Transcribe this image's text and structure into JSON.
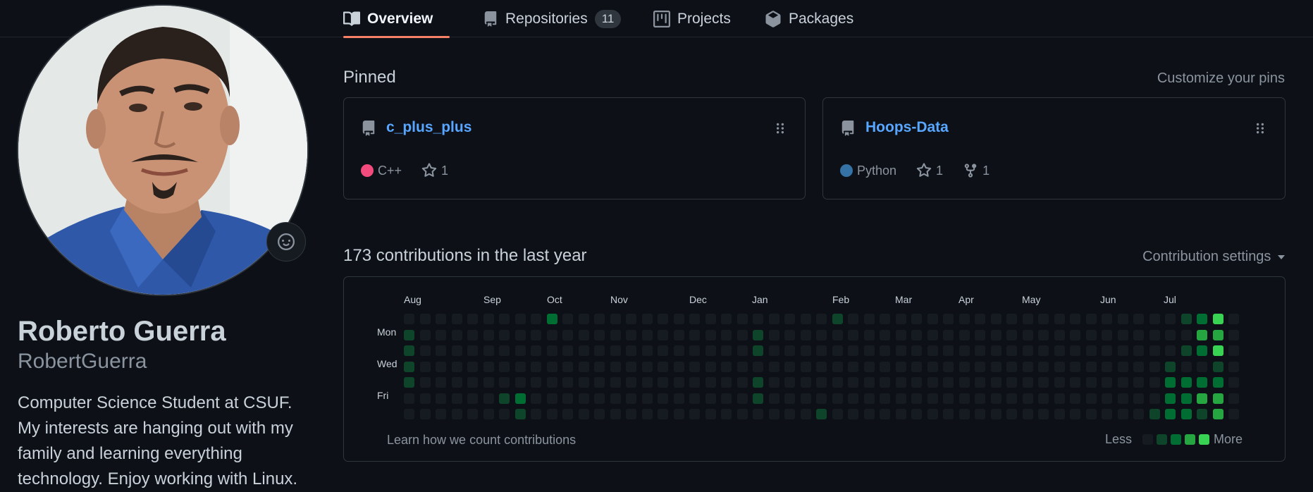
{
  "nav": {
    "tabs": [
      {
        "label": "Overview",
        "icon": "book-icon"
      },
      {
        "label": "Repositories",
        "icon": "repo-icon",
        "count": "11"
      },
      {
        "label": "Projects",
        "icon": "project-icon"
      },
      {
        "label": "Packages",
        "icon": "package-icon"
      }
    ]
  },
  "profile": {
    "full_name": "Roberto Guerra",
    "login": "RobertGuerra",
    "bio": "Computer Science Student at CSUF. My interests are hanging out with my family and learning everything technology. Enjoy working with Linux."
  },
  "pinned": {
    "title": "Pinned",
    "customize_label": "Customize your pins",
    "repos": [
      {
        "name": "c_plus_plus",
        "language": "C++",
        "language_color": "#f34b7d",
        "stars": "1"
      },
      {
        "name": "Hoops-Data",
        "language": "Python",
        "language_color": "#3572A5",
        "stars": "1",
        "forks": "1"
      }
    ]
  },
  "contributions": {
    "title": "173 contributions in the last year",
    "settings_label": "Contribution settings",
    "months": [
      "Aug",
      "Sep",
      "Oct",
      "Nov",
      "Dec",
      "Jan",
      "Feb",
      "Mar",
      "Apr",
      "May",
      "Jun",
      "Jul"
    ],
    "day_labels": [
      "Mon",
      "Wed",
      "Fri"
    ],
    "learn_link": "Learn how we count contributions",
    "legend_less": "Less",
    "legend_more": "More",
    "colors": [
      "#161b22",
      "#0e4429",
      "#006d32",
      "#26a641",
      "#39d353"
    ],
    "weeks": 53,
    "active_cells": [
      {
        "week": 9,
        "day": 0,
        "level": 2
      },
      {
        "week": 0,
        "day": 1,
        "level": 1
      },
      {
        "week": 0,
        "day": 2,
        "level": 1
      },
      {
        "week": 0,
        "day": 3,
        "level": 1
      },
      {
        "week": 0,
        "day": 4,
        "level": 1
      },
      {
        "week": 6,
        "day": 5,
        "level": 1
      },
      {
        "week": 7,
        "day": 5,
        "level": 2
      },
      {
        "week": 7,
        "day": 6,
        "level": 1
      },
      {
        "week": 22,
        "day": 1,
        "level": 1
      },
      {
        "week": 22,
        "day": 2,
        "level": 1
      },
      {
        "week": 22,
        "day": 4,
        "level": 1
      },
      {
        "week": 22,
        "day": 5,
        "level": 1
      },
      {
        "week": 26,
        "day": 6,
        "level": 1
      },
      {
        "week": 27,
        "day": 0,
        "level": 1
      },
      {
        "week": 47,
        "day": 6,
        "level": 1
      },
      {
        "week": 48,
        "day": 3,
        "level": 1
      },
      {
        "week": 48,
        "day": 4,
        "level": 2
      },
      {
        "week": 48,
        "day": 5,
        "level": 2
      },
      {
        "week": 48,
        "day": 6,
        "level": 2
      },
      {
        "week": 49,
        "day": 0,
        "level": 1
      },
      {
        "week": 49,
        "day": 4,
        "level": 2
      },
      {
        "week": 49,
        "day": 5,
        "level": 2
      },
      {
        "week": 49,
        "day": 6,
        "level": 2
      },
      {
        "week": 49,
        "day": 2,
        "level": 1
      },
      {
        "week": 50,
        "day": 0,
        "level": 2
      },
      {
        "week": 50,
        "day": 1,
        "level": 3
      },
      {
        "week": 50,
        "day": 2,
        "level": 2
      },
      {
        "week": 50,
        "day": 4,
        "level": 2
      },
      {
        "week": 50,
        "day": 5,
        "level": 3
      },
      {
        "week": 50,
        "day": 6,
        "level": 1
      },
      {
        "week": 51,
        "day": 0,
        "level": 4
      },
      {
        "week": 51,
        "day": 1,
        "level": 3
      },
      {
        "week": 51,
        "day": 2,
        "level": 4
      },
      {
        "week": 51,
        "day": 3,
        "level": 1
      },
      {
        "week": 51,
        "day": 4,
        "level": 2
      },
      {
        "week": 51,
        "day": 5,
        "level": 3
      },
      {
        "week": 51,
        "day": 6,
        "level": 3
      }
    ]
  }
}
